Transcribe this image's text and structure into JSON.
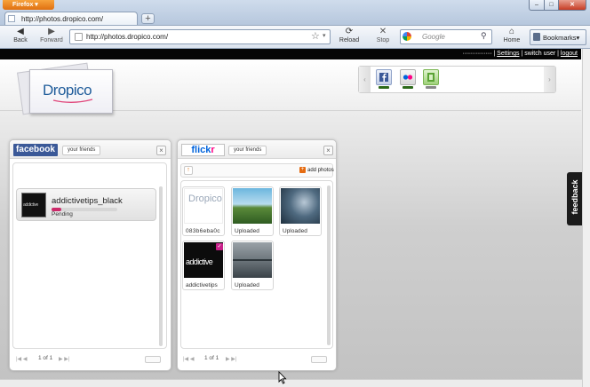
{
  "browser": {
    "menu_label": "Firefox",
    "tab_title": "http://photos.dropico.com/",
    "new_tab": "+",
    "window_controls": {
      "minimize": "–",
      "maximize": "□",
      "close": "✕"
    },
    "toolbar": {
      "back": "Back",
      "forward": "Forward",
      "reload": "Reload",
      "stop": "Stop",
      "home": "Home",
      "bookmarks": "Bookmarks"
    },
    "url": "http://photos.dropico.com/",
    "search_placeholder": "Google"
  },
  "site": {
    "logo": "Dropico",
    "userbar": {
      "username": "··················",
      "settings": "Settings",
      "switch_user": "switch user",
      "logout": "logout"
    },
    "feedback": "feedback"
  },
  "panels": {
    "facebook": {
      "brand": "facebook",
      "friends_button": "your friends",
      "close": "×",
      "album": {
        "name": "addictivetips_black",
        "status": "Pending",
        "progress": 0.15,
        "thumb_text": "addictive"
      },
      "pager": "1 of 1"
    },
    "flickr": {
      "brand_part1": "flick",
      "brand_part2": "r",
      "friends_button": "your friends",
      "close": "×",
      "add_photos": "add photos",
      "photos": [
        {
          "caption": "083b6eba0c"
        },
        {
          "caption": "Uploaded"
        },
        {
          "caption": "Uploaded"
        },
        {
          "caption": "addictivetips"
        },
        {
          "caption": "Uploaded"
        }
      ],
      "thumb1_logo": "Dropico",
      "thumb4_text": "addictive",
      "pager": "1 of 1"
    }
  },
  "colors": {
    "facebook_blue": "#3b5998",
    "flickr_blue": "#0063dc",
    "flickr_pink": "#ff0084",
    "firefox_orange": "#e07010",
    "progress_pink": "#cc2a6a"
  }
}
